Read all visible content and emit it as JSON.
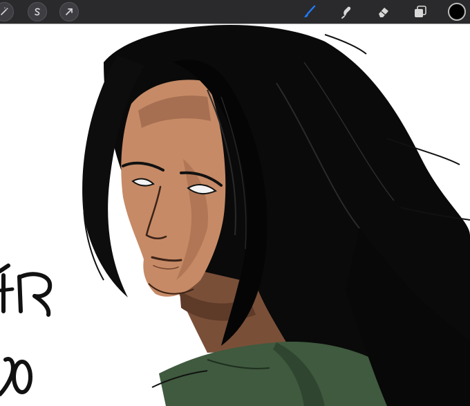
{
  "toolbar": {
    "left_tools": [
      {
        "name": "adjustments-magic-wand-icon"
      },
      {
        "name": "selection-s-icon"
      },
      {
        "name": "transform-arrow-icon"
      }
    ],
    "right_tools": [
      {
        "name": "brush-icon",
        "active": true
      },
      {
        "name": "smudge-icon",
        "active": false
      },
      {
        "name": "eraser-icon",
        "active": false
      },
      {
        "name": "layers-icon",
        "active": false
      }
    ],
    "current_color": "#000000",
    "active_tool_color": "#1f7cff",
    "icon_color": "#d8d8d8"
  },
  "canvas": {
    "background": "#ffffff",
    "artwork": "painted-portrait"
  }
}
